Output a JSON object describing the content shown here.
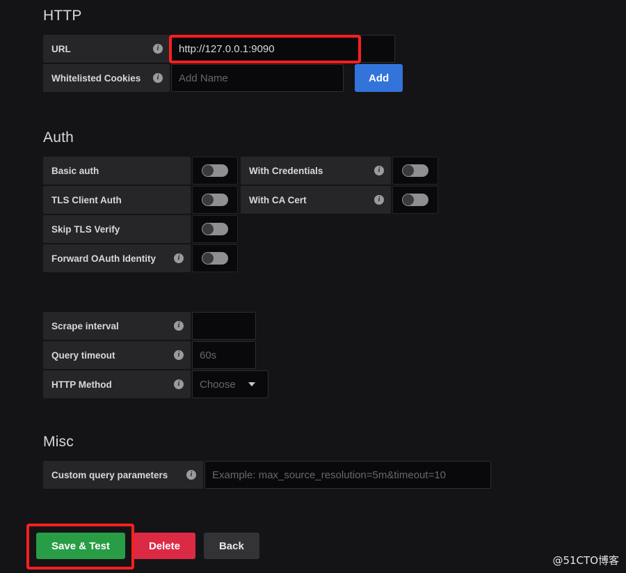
{
  "colors": {
    "page_bg": "#141417",
    "label_bg": "#262628",
    "field_bg": "#09090b",
    "accent_blue": "#3274d9",
    "save_green": "#299c46",
    "delete_red": "#dc2a45",
    "back_grey": "#333335",
    "annotation_red": "#ff1f1f"
  },
  "http": {
    "title": "HTTP",
    "url": {
      "label": "URL",
      "info_icon": "info-icon",
      "value": "http://127.0.0.1:9090"
    },
    "whitelisted_cookies": {
      "label": "Whitelisted Cookies",
      "info_icon": "info-icon",
      "value": "",
      "placeholder": "Add Name",
      "add_button": "Add"
    }
  },
  "auth": {
    "title": "Auth",
    "toggles_left": [
      {
        "label": "Basic auth",
        "has_info": false,
        "state": "off"
      },
      {
        "label": "TLS Client Auth",
        "has_info": false,
        "state": "off"
      },
      {
        "label": "Skip TLS Verify",
        "has_info": false,
        "state": "off"
      },
      {
        "label": "Forward OAuth Identity",
        "has_info": true,
        "state": "off"
      }
    ],
    "toggles_right": [
      {
        "label": "With Credentials",
        "has_info": true,
        "state": "off"
      },
      {
        "label": "With CA Cert",
        "has_info": true,
        "state": "off"
      }
    ]
  },
  "interval": {
    "scrape_interval": {
      "label": "Scrape interval",
      "info_icon": "info-icon",
      "value": "",
      "placeholder": ""
    },
    "query_timeout": {
      "label": "Query timeout",
      "info_icon": "info-icon",
      "value": "",
      "placeholder": "60s"
    },
    "http_method": {
      "label": "HTTP Method",
      "info_icon": "info-icon",
      "selected": "Choose",
      "caret_icon": "chevron-down-icon"
    }
  },
  "misc": {
    "title": "Misc",
    "custom_query_parameters": {
      "label": "Custom query parameters",
      "info_icon": "info-icon",
      "value": "",
      "placeholder": "Example: max_source_resolution=5m&timeout=10"
    }
  },
  "actions": {
    "save": "Save & Test",
    "delete": "Delete",
    "back": "Back"
  },
  "watermark": {
    "text": "@51CTO博客"
  }
}
